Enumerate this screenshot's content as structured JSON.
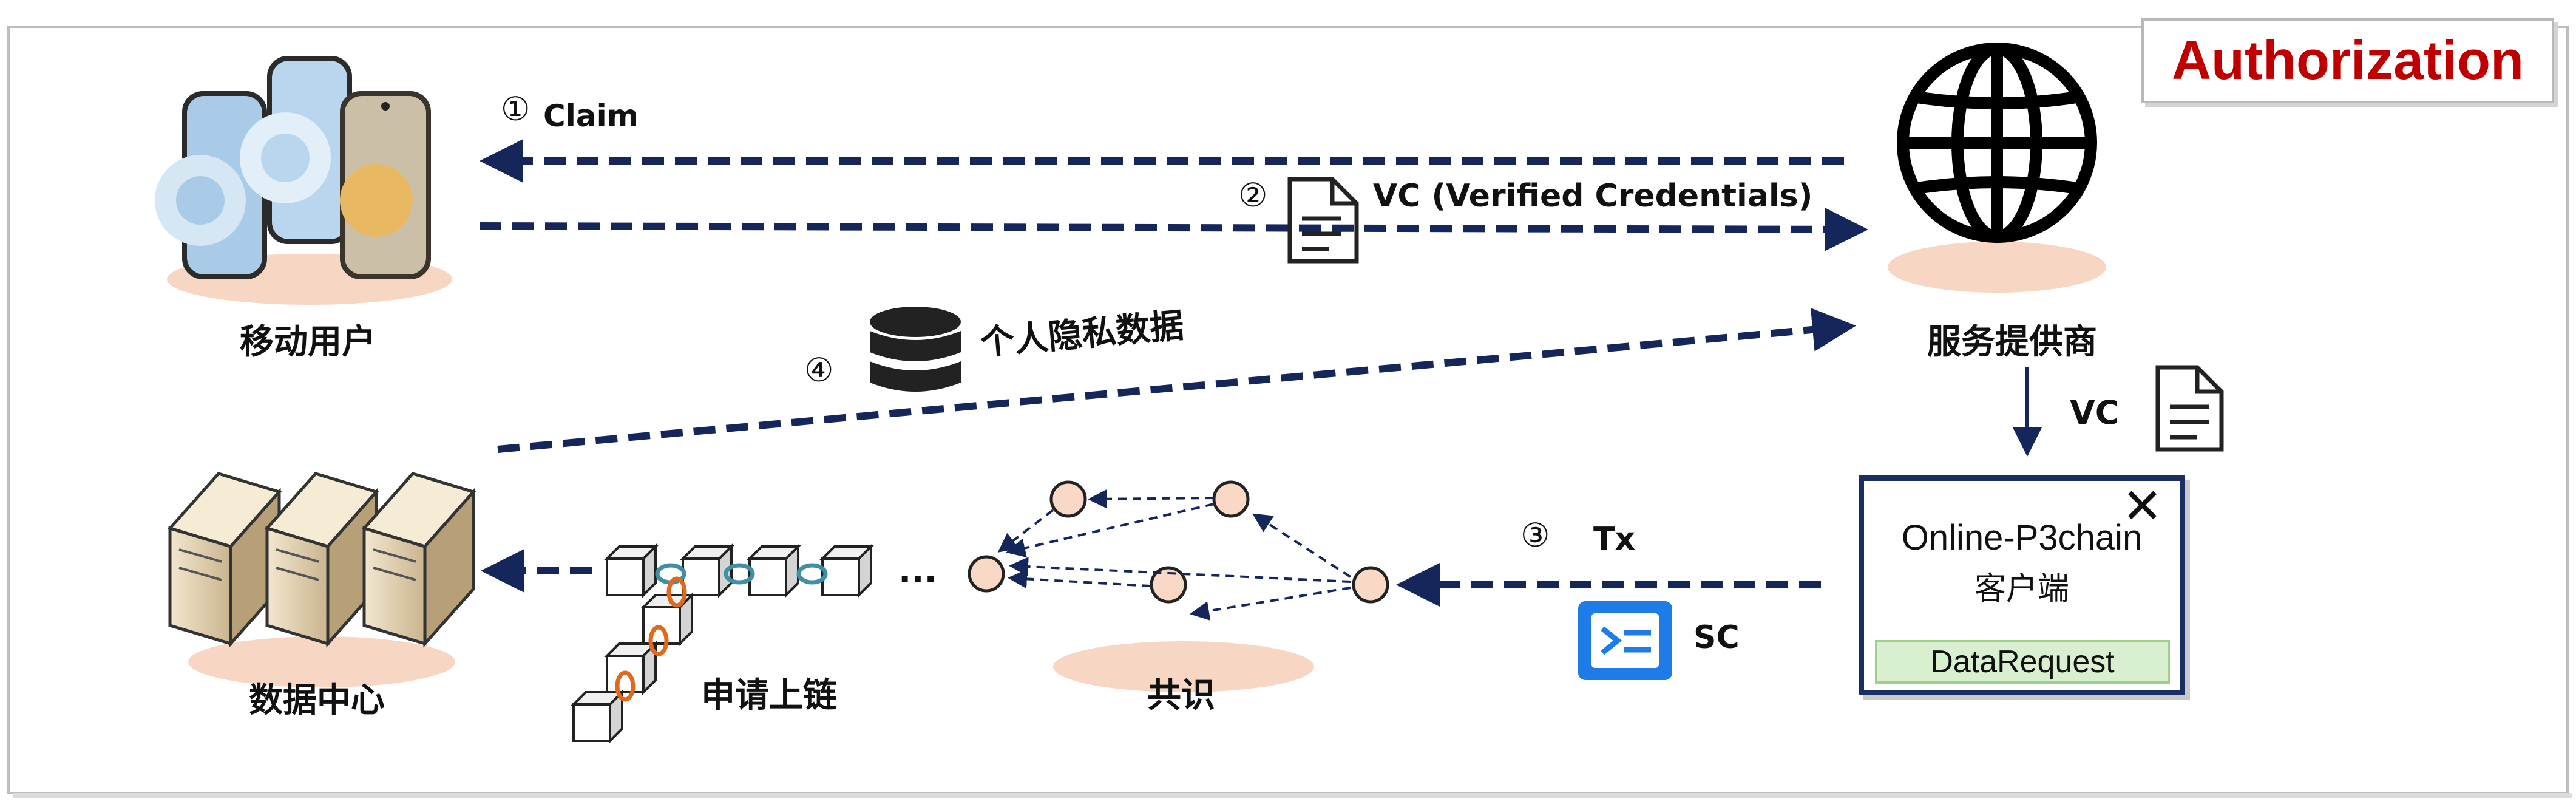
{
  "badge": {
    "label": "Authorization"
  },
  "actors": {
    "mobile_user": "移动用户",
    "service_provider": "服务提供商",
    "data_center": "数据中心",
    "consensus": "共识",
    "chain_apply": "申请上链"
  },
  "steps": {
    "claim_num": "①",
    "claim": "Claim",
    "vc_num": "②",
    "vc_full": "VC (Verified Credentials)",
    "tx_num": "③",
    "tx": "Tx",
    "sc": "SC",
    "private_num": "④",
    "private": "个人隐私数据",
    "vc_short": "VC",
    "ellipsis": "..."
  },
  "client": {
    "title": "Online-P3chain",
    "subtitle": "客户端",
    "close": "✕",
    "button": "DataRequest"
  },
  "colors": {
    "arrow": "#14265a",
    "badge_text": "#c00000",
    "ellipse": "#f7d6c4",
    "node": "#f9d9c6"
  }
}
